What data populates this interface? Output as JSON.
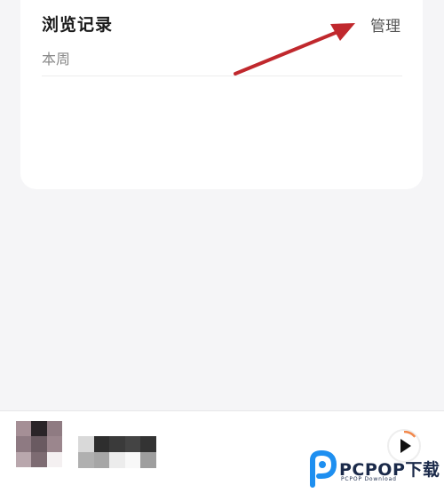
{
  "history": {
    "title": "浏览记录",
    "manage_label": "管理",
    "period_label": "本周"
  },
  "watermark": {
    "brand": "PCPOP下载",
    "sub": "PCPOP Download"
  },
  "player": {
    "play_icon": "play-icon"
  },
  "colors": {
    "annotation_arrow": "#c0282d",
    "watermark_blue": "#1e8ff0",
    "progress_orange": "#f2884b"
  }
}
